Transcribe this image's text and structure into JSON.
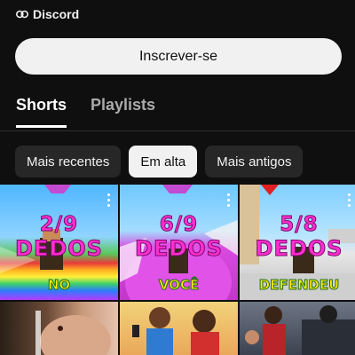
{
  "channel": {
    "link_label": "Discord"
  },
  "subscribe_label": "Inscrever-se",
  "tabs": [
    {
      "label": "Shorts",
      "active": true
    },
    {
      "label": "Playlists",
      "active": false
    }
  ],
  "filters": [
    {
      "label": "Mais recentes",
      "active": false
    },
    {
      "label": "Em alta",
      "active": true
    },
    {
      "label": "Mais antigos",
      "active": false
    }
  ],
  "shorts": [
    {
      "score": "2/9",
      "dedos": "DEDOS",
      "word": "NO"
    },
    {
      "score": "6/9",
      "dedos": "DEDOS",
      "word": "VOCÊ"
    },
    {
      "score": "5/8",
      "dedos": "DEDOS",
      "word": "DEFENDEU"
    }
  ],
  "colors": {
    "background": "#0f0f0f",
    "chip_bg": "#272727",
    "button_bg": "#f1f1f1",
    "overlay_text": "#ff2fd0"
  }
}
